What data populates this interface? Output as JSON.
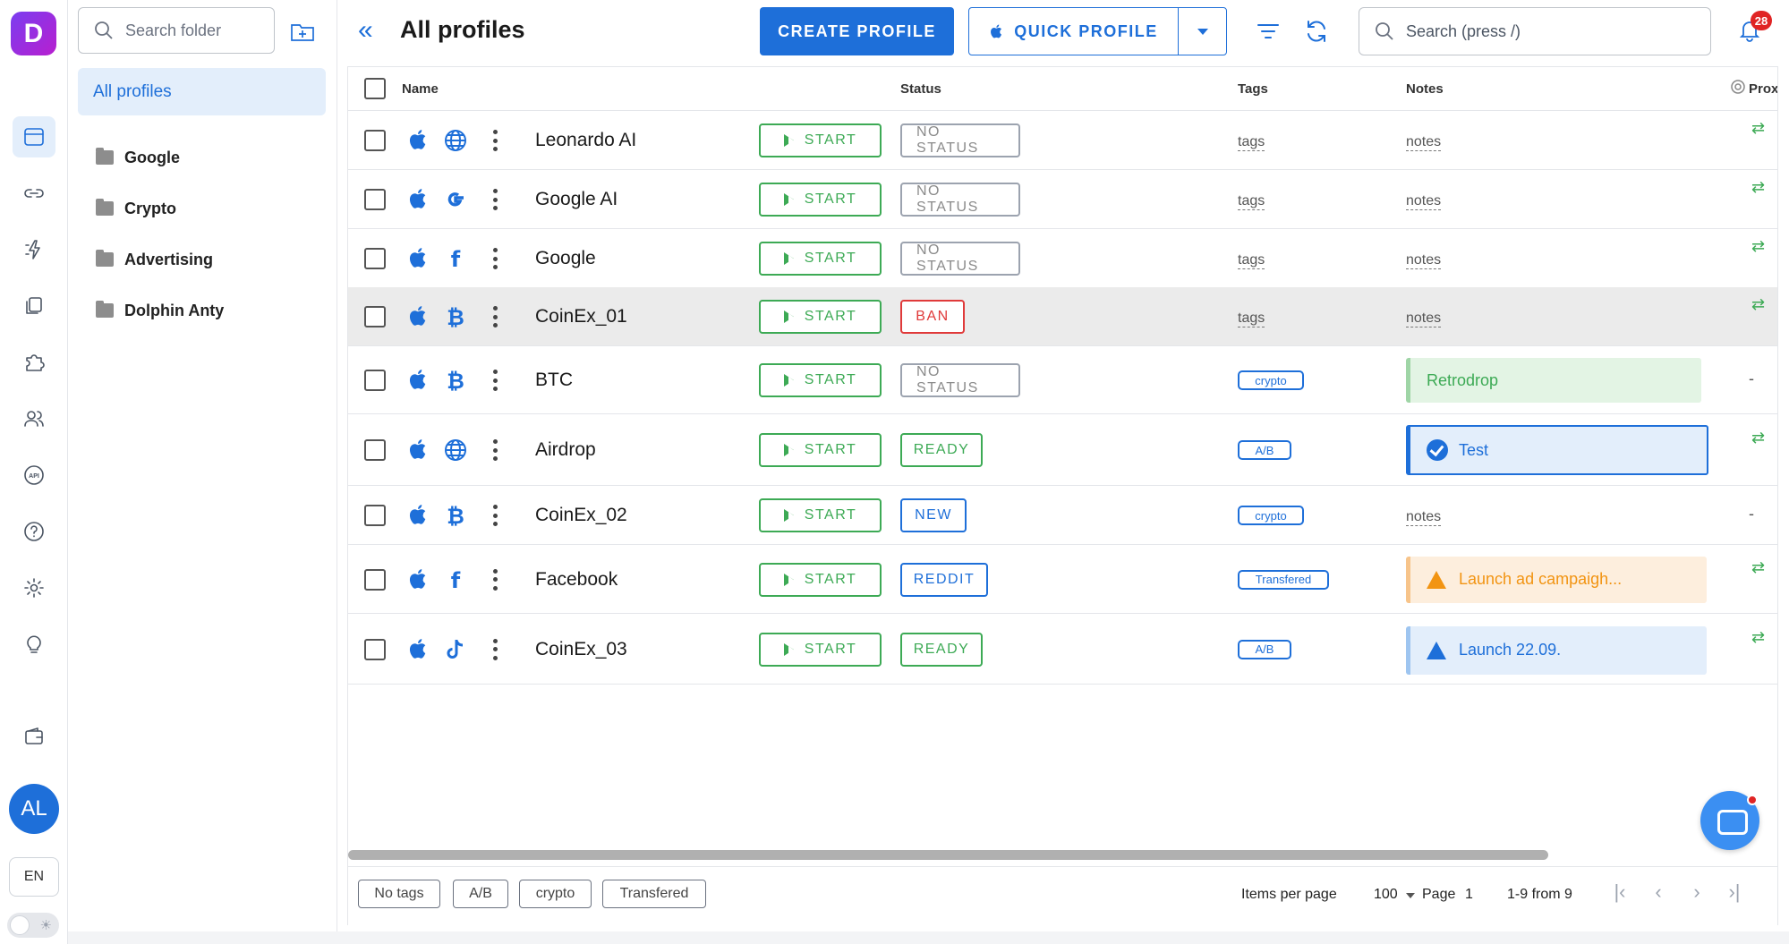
{
  "app": {
    "logo_letter": "D",
    "accent": "#1e6fd9"
  },
  "rail": {
    "items": [
      {
        "icon": "browser-profiles-icon",
        "active": true
      },
      {
        "icon": "link-icon"
      },
      {
        "icon": "automation-icon"
      },
      {
        "icon": "copy-icon"
      },
      {
        "icon": "puzzle-icon"
      },
      {
        "icon": "users-icon"
      },
      {
        "icon": "api-icon"
      },
      {
        "icon": "help-icon"
      },
      {
        "icon": "settings-icon"
      },
      {
        "icon": "lightbulb-icon"
      },
      {
        "icon": "wallet-icon"
      }
    ],
    "avatar": "AL",
    "language": "EN"
  },
  "folders": {
    "search_placeholder": "Search folder",
    "all_label": "All profiles",
    "items": [
      "Google",
      "Crypto",
      "Advertising",
      "Dolphin Anty"
    ]
  },
  "header": {
    "title": "All profiles",
    "create_label": "CREATE PROFILE",
    "quick_label": "QUICK PROFILE",
    "search_placeholder": "Search (press /)",
    "notifications": "28"
  },
  "table": {
    "columns": {
      "name": "Name",
      "status": "Status",
      "tags": "Tags",
      "notes": "Notes",
      "proxy": "Prox"
    },
    "start_label": "START",
    "rows": [
      {
        "name": "Leonardo AI",
        "site": "globe",
        "status": "NO STATUS",
        "tags": "tags",
        "notes": "notes",
        "proxy": "⇄"
      },
      {
        "name": "Google AI",
        "site": "google",
        "status": "NO STATUS",
        "tags": "tags",
        "notes": "notes",
        "proxy": "⇄"
      },
      {
        "name": "Google",
        "site": "facebook",
        "status": "NO STATUS",
        "tags": "tags",
        "notes": "notes",
        "proxy": "⇄"
      },
      {
        "name": "CoinEx_01",
        "site": "bitcoin",
        "status": "BAN",
        "tags": "tags",
        "notes": "notes",
        "proxy": "⇄"
      },
      {
        "name": "BTC",
        "site": "bitcoin",
        "status": "NO STATUS",
        "tags": "crypto",
        "notes": "Retrodrop",
        "proxy": "-"
      },
      {
        "name": "Airdrop",
        "site": "globe",
        "status": "READY",
        "tags": "A/B",
        "notes": "Test",
        "proxy": "⇄"
      },
      {
        "name": "CoinEx_02",
        "site": "bitcoin",
        "status": "NEW",
        "tags": "crypto",
        "notes": "notes",
        "proxy": "-"
      },
      {
        "name": "Facebook",
        "site": "facebook",
        "status": "REDDIT",
        "tags": "Transfered",
        "notes": "Launch ad campaigh...",
        "proxy": "⇄"
      },
      {
        "name": "CoinEx_03",
        "site": "tiktok",
        "status": "READY",
        "tags": "A/B",
        "notes": "Launch 22.09.",
        "proxy": "⇄"
      }
    ]
  },
  "footer": {
    "tag_filters": [
      "No tags",
      "A/B",
      "crypto",
      "Transfered"
    ],
    "items_per_page_label": "Items per page",
    "items_per_page": "100",
    "page_label": "Page",
    "page": "1",
    "range": "1-9 from 9"
  },
  "colors": {
    "start_green": "#3daa55",
    "status_gray": "#8a8a8a",
    "status_red": "#e03a3a",
    "note_green_bg": "#e3f4e4",
    "note_blue_bg": "#e3eefb",
    "note_orange_bg": "#fdeedd"
  }
}
